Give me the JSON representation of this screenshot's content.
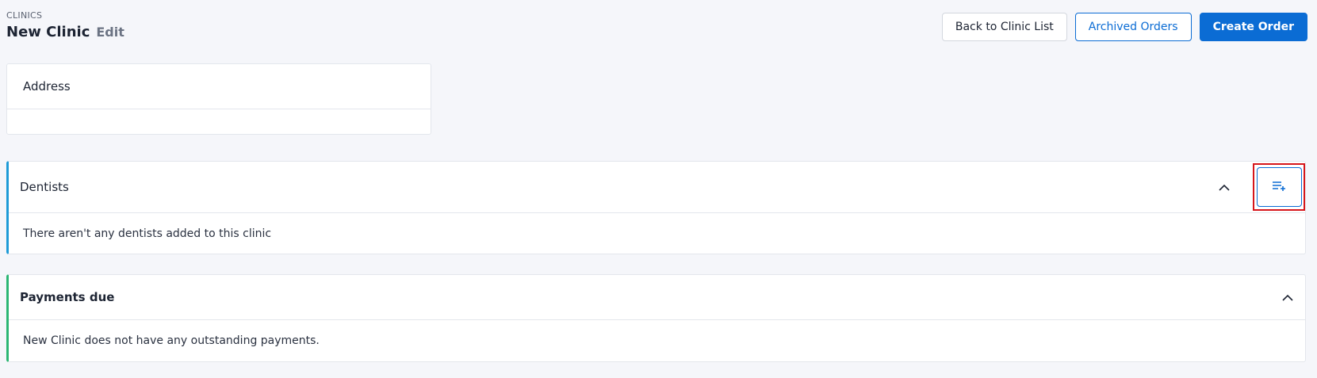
{
  "header": {
    "breadcrumb": "CLINICS",
    "title": "New Clinic",
    "edit_label": "Edit"
  },
  "actions": {
    "back_label": "Back to Clinic List",
    "archived_label": "Archived Orders",
    "create_label": "Create Order"
  },
  "address": {
    "title": "Address"
  },
  "dentists": {
    "title": "Dentists",
    "empty_message": "There aren't any dentists added to this clinic",
    "accent_color": "#1e9bd7"
  },
  "payments": {
    "title": "Payments due",
    "empty_message": "New Clinic does not have any outstanding payments.",
    "accent_color": "#2bb673"
  },
  "icons": {
    "collapse": "chevron-up-icon",
    "add_dentist": "playlist-add-icon"
  },
  "colors": {
    "primary": "#0b6cd4",
    "highlight": "#d6161b",
    "background": "#f5f6fa"
  }
}
